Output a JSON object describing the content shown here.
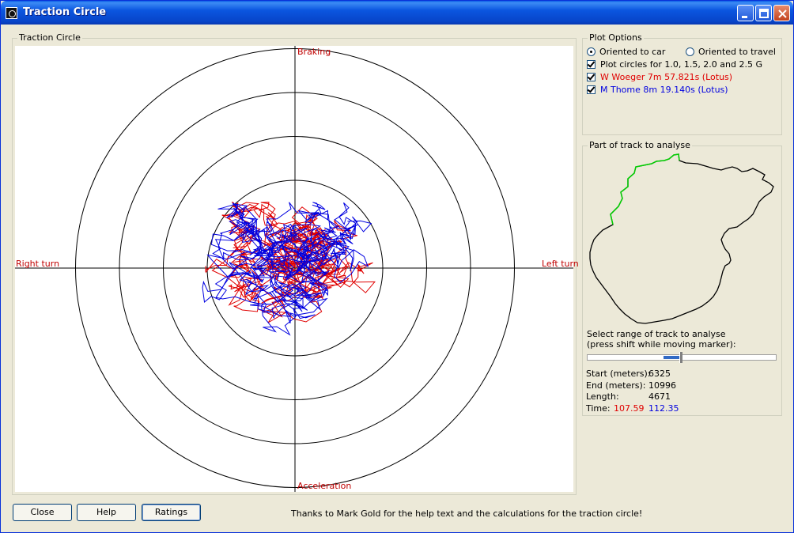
{
  "window": {
    "title": "Traction Circle"
  },
  "plot": {
    "group_label": "Traction Circle",
    "labels": {
      "top": "Braking",
      "bottom": "Acceleration",
      "left": "Right turn",
      "right": "Left turn"
    },
    "circles_g": [
      1.0,
      1.5,
      2.0,
      2.5
    ],
    "axis_color": "#000000",
    "series": [
      {
        "name": "W Woeger",
        "color": "#e00000"
      },
      {
        "name": "M Thome",
        "color": "#0000e0"
      }
    ]
  },
  "options": {
    "group_label": "Plot Options",
    "orientation": [
      {
        "label": "Oriented to car",
        "selected": true
      },
      {
        "label": "Oriented to travel",
        "selected": false
      }
    ],
    "checks": [
      {
        "label": "Plot circles for 1.0, 1.5, 2.0 and 2.5 G",
        "checked": true,
        "color": "#000000"
      },
      {
        "label": "W Woeger 7m 57.821s (Lotus)",
        "checked": true,
        "color": "#e00000"
      },
      {
        "label": "M Thome 8m 19.140s (Lotus)",
        "checked": true,
        "color": "#0000e0"
      }
    ]
  },
  "track": {
    "group_label": "Part of track to analyse",
    "select_text_1": "Select range of track to analyse",
    "select_text_2": "(press shift while moving marker):",
    "start_label": "Start (meters):",
    "start_value": "6325",
    "end_label": "End (meters):",
    "end_value": "10996",
    "length_label": "Length:",
    "length_value": "4671",
    "time_label": "Time:",
    "time_value_1": "107.59",
    "time_value_2": "112.35",
    "time_color_1": "#e00000",
    "time_color_2": "#0000e0"
  },
  "buttons": {
    "close": "Close",
    "help": "Help",
    "ratings": "Ratings"
  },
  "footer": "Thanks to Mark Gold for the help text and the calculations for the traction circle!"
}
